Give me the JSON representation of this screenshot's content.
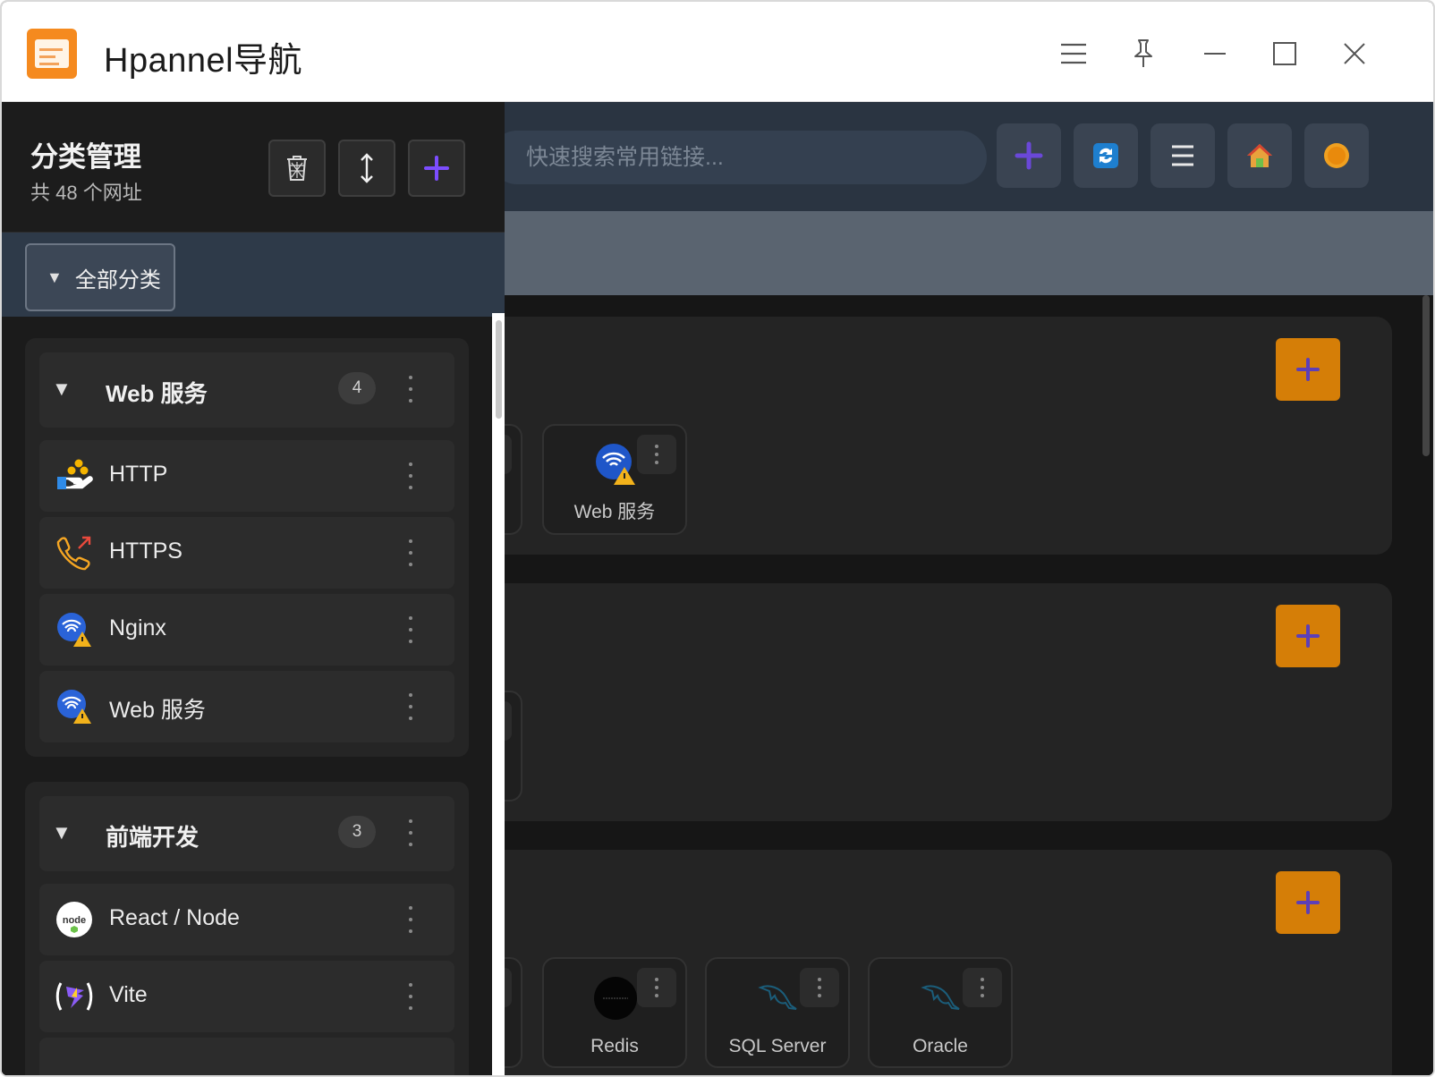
{
  "window": {
    "title": "Hpannel导航",
    "controls": [
      "menu-icon",
      "pin-icon",
      "minimize-icon",
      "maximize-icon",
      "close-icon"
    ]
  },
  "header": {
    "search_placeholder": "快速搜索常用链接...",
    "buttons": [
      "add-icon",
      "sync-icon",
      "list-icon",
      "home-icon",
      "theme-icon"
    ]
  },
  "sidebar": {
    "title": "分类管理",
    "subtitle": "共 48 个网址",
    "filter_label": "全部分类",
    "categories": [
      {
        "name": "Web 服务",
        "count": "4",
        "items": [
          {
            "label": "HTTP",
            "icon": "network-hand-icon"
          },
          {
            "label": "HTTPS",
            "icon": "phone-arrow-icon"
          },
          {
            "label": "Nginx",
            "icon": "wifi-warning-icon"
          },
          {
            "label": "Web 服务",
            "icon": "wifi-warning-icon"
          }
        ]
      },
      {
        "name": "前端开发",
        "count": "3",
        "items": [
          {
            "label": "React / Node",
            "icon": "node-icon"
          },
          {
            "label": "Vite",
            "icon": "vite-icon"
          }
        ]
      }
    ]
  },
  "content": {
    "cards": {
      "group1": [
        "Web 服务"
      ],
      "group3": [
        "Redis",
        "SQL Server",
        "Oracle"
      ]
    }
  },
  "colors": {
    "accent_orange": "#d57e07",
    "accent_purple": "#7c4dff",
    "header_bg": "#2a3441"
  }
}
